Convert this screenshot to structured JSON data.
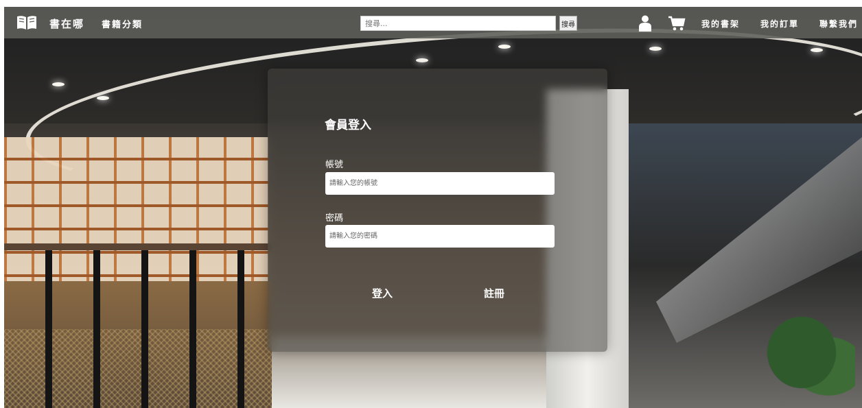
{
  "navbar": {
    "logo_icon": "open-book-icon",
    "brand": "書在哪",
    "categories": "書籍分類",
    "search": {
      "placeholder": "搜尋...",
      "button_label": "搜尋"
    },
    "user_icon": "user-icon",
    "cart_icon": "shopping-cart-icon",
    "links": [
      "我的書架",
      "我的訂單",
      "聯繫我們"
    ]
  },
  "login": {
    "title": "會員登入",
    "account_label": "帳號",
    "account_placeholder": "請輸入您的帳號",
    "password_label": "密碼",
    "password_placeholder": "請輸入您的密碼",
    "login_button": "登入",
    "register_button": "註冊"
  },
  "colors": {
    "navbar": "#5f5f5a",
    "text": "#ffffff"
  }
}
